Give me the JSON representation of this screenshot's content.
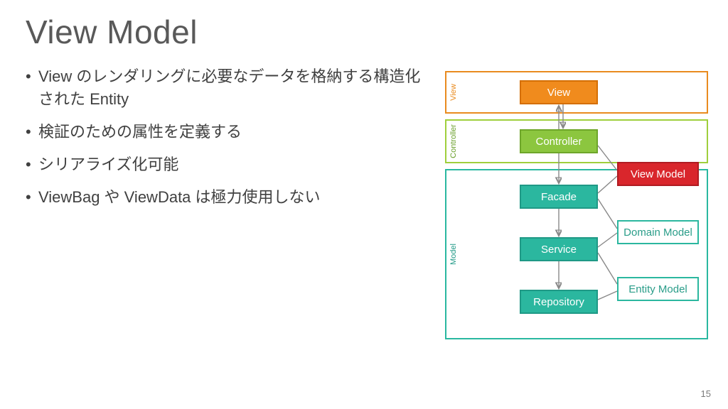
{
  "title": "View Model",
  "bullets": [
    "View のレンダリングに必要なデータを格納する構造化された Entity",
    "検証のための属性を定義する",
    "シリアライズ化可能",
    "ViewBag や ViewData は極力使用しない"
  ],
  "page_number": "15",
  "diagram": {
    "layers": {
      "view": "View",
      "controller": "Controller",
      "model": "Model"
    },
    "boxes": {
      "view": "View",
      "controller": "Controller",
      "facade": "Facade",
      "service": "Service",
      "repository": "Repository",
      "view_model": "View Model",
      "domain_model": "Domain Model",
      "entity_model": "Entity Model"
    }
  }
}
